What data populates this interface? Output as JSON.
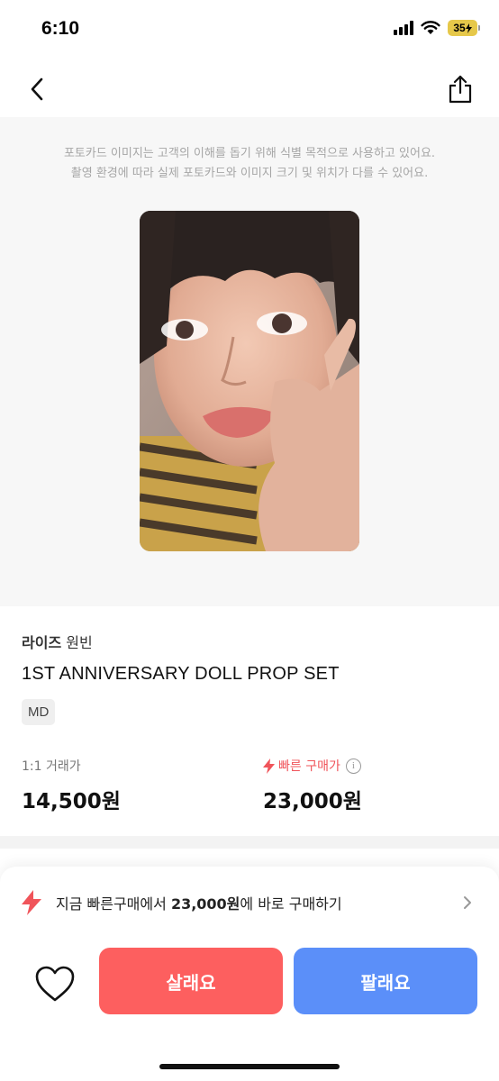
{
  "status_bar": {
    "time": "6:10",
    "battery": "35",
    "icons": [
      "signal-icon",
      "wifi-icon",
      "battery-charging-icon"
    ]
  },
  "nav": {
    "back_icon": "chevron-left-icon",
    "share_icon": "share-icon"
  },
  "image_section": {
    "disclaimer_line1": "포토카드 이미지는 고객의 이해를 돕기 위해 식별 목적으로 사용하고 있어요.",
    "disclaimer_line2": "촬영 환경에 따라 실제 포토카드와 이미지 크기 및 위치가 다를 수 있어요.",
    "background_color": "#f7f7f7"
  },
  "product": {
    "group": "라이즈",
    "member": "원빈",
    "title": "1ST ANNIVERSARY DOLL PROP SET",
    "tag": "MD"
  },
  "prices": {
    "trade_label": "1:1 거래가",
    "trade_value": "14,500원",
    "fast_label": "빠른 구매가",
    "fast_value": "23,000원",
    "info_symbol": "i"
  },
  "quick_buy": {
    "prefix": "지금 빠른구매에서 ",
    "amount": "23,000원",
    "suffix": "에 바로 구매하기"
  },
  "actions": {
    "buy_label": "살래요",
    "sell_label": "팔래요"
  },
  "colors": {
    "buy": "#fd5f5f",
    "sell": "#5b8ff9",
    "fast_accent": "#f0545a",
    "muted_text": "#a6a6a6"
  }
}
